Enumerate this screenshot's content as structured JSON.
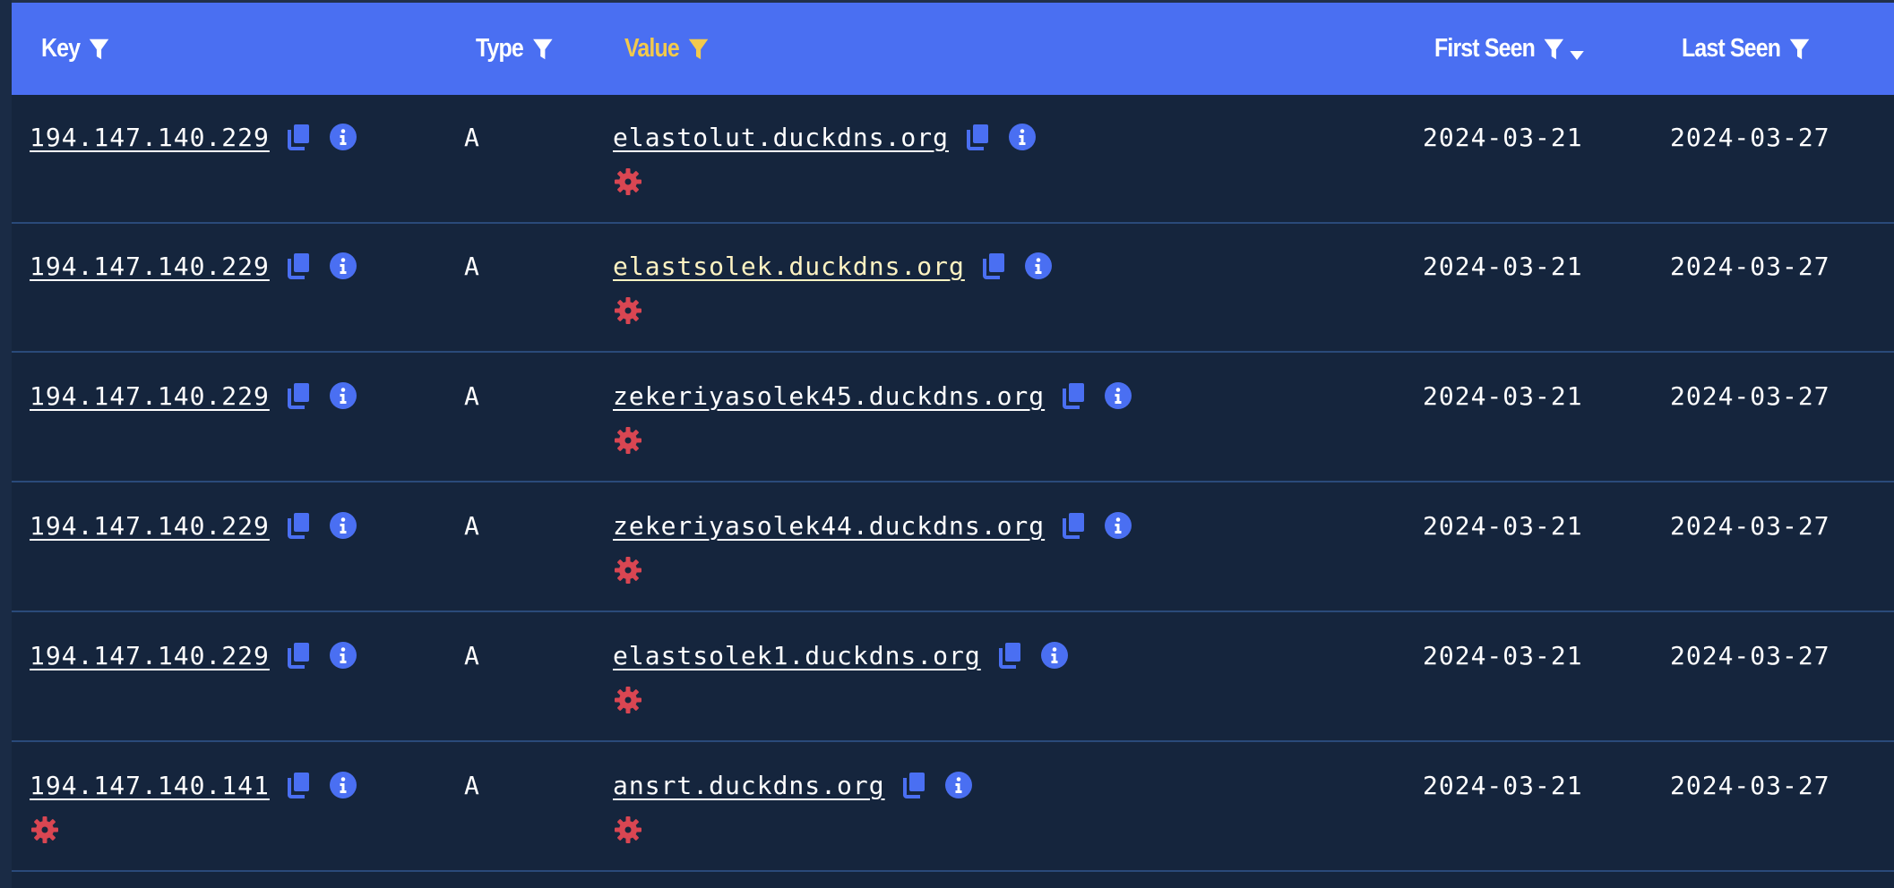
{
  "table": {
    "columns": [
      {
        "label": "Key",
        "active": false,
        "sorted": false
      },
      {
        "label": "Type",
        "active": false,
        "sorted": false
      },
      {
        "label": "Value",
        "active": true,
        "sorted": false
      },
      {
        "label": "First Seen",
        "active": false,
        "sorted": true,
        "sort_direction": "descending"
      },
      {
        "label": "Last Seen",
        "active": false,
        "sorted": false
      }
    ],
    "rows": [
      {
        "key": "194.147.140.229",
        "key_flag": false,
        "type": "A",
        "value": "elastolut.duckdns.org",
        "value_flag": true,
        "first_seen": "2024-03-21",
        "last_seen": "2024-03-27"
      },
      {
        "key": "194.147.140.229",
        "key_flag": false,
        "type": "A",
        "value": "elastsolek.duckdns.org",
        "value_flag": true,
        "first_seen": "2024-03-21",
        "last_seen": "2024-03-27"
      },
      {
        "key": "194.147.140.229",
        "key_flag": false,
        "type": "A",
        "value": "zekeriyasolek45.duckdns.org",
        "value_flag": true,
        "first_seen": "2024-03-21",
        "last_seen": "2024-03-27"
      },
      {
        "key": "194.147.140.229",
        "key_flag": false,
        "type": "A",
        "value": "zekeriyasolek44.duckdns.org",
        "value_flag": true,
        "first_seen": "2024-03-21",
        "last_seen": "2024-03-27"
      },
      {
        "key": "194.147.140.229",
        "key_flag": false,
        "type": "A",
        "value": "elastsolek1.duckdns.org",
        "value_flag": true,
        "first_seen": "2024-03-21",
        "last_seen": "2024-03-27"
      },
      {
        "key": "194.147.140.141",
        "key_flag": true,
        "type": "A",
        "value": "ansrt.duckdns.org",
        "value_flag": true,
        "first_seen": "2024-03-21",
        "last_seen": "2024-03-27"
      }
    ]
  },
  "icons": {
    "filter": "filter-icon",
    "sort": "sort-descending-icon",
    "copy": "copy-icon",
    "info": "info-icon",
    "malware": "malware-gear-icon"
  },
  "colors": {
    "header_bg": "#4a6ff2",
    "header_text": "#ffffff",
    "active_header_text": "#f2c94c",
    "row_bg": "#15253d",
    "row_divider": "#2a4a7a",
    "icon_blue": "#4a6ff2",
    "malware_red": "#d94652",
    "hover_link": "#fff3c2"
  }
}
